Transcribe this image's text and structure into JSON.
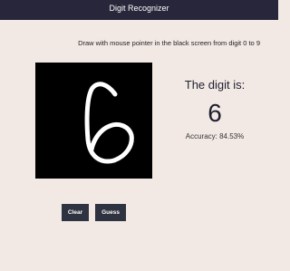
{
  "header": {
    "title": "Digit Recognizer"
  },
  "instructions": "Draw with mouse pointer in the black screen from digit 0 to 9",
  "result": {
    "label": "The digit is:",
    "digit": "6",
    "accuracy_text": "Accuracy: 84.53%"
  },
  "buttons": {
    "clear_label": "Clear",
    "guess_label": "Guess"
  },
  "colors": {
    "header_bg": "#27263a",
    "page_bg": "#f2e9e5",
    "canvas_bg": "#000000",
    "stroke": "#ffffff",
    "button_bg": "#2f3240"
  }
}
